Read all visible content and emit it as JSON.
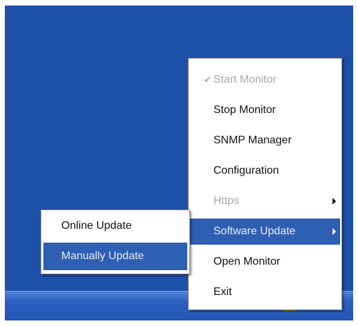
{
  "context_menu": {
    "items": [
      {
        "label": "Start Monitor",
        "checked": true,
        "disabled": true
      },
      {
        "label": "Stop Monitor"
      },
      {
        "label": "SNMP Manager"
      },
      {
        "label": "Configuration"
      },
      {
        "label": "Https",
        "disabled": true,
        "has_submenu": true
      },
      {
        "label": "Software Update",
        "has_submenu": true,
        "highlighted": true
      },
      {
        "label": "Open Monitor"
      },
      {
        "label": "Exit"
      }
    ]
  },
  "submenu": {
    "items": [
      {
        "label": "Online Update"
      },
      {
        "label": "Manually Update",
        "highlighted": true
      }
    ]
  },
  "icons": {
    "check": "✔",
    "submenu_arrow": "triangle-right"
  },
  "colors": {
    "desktop": "#1d50a8",
    "highlight": "#2f5fb3",
    "disabled_text": "#a8a8a8"
  }
}
